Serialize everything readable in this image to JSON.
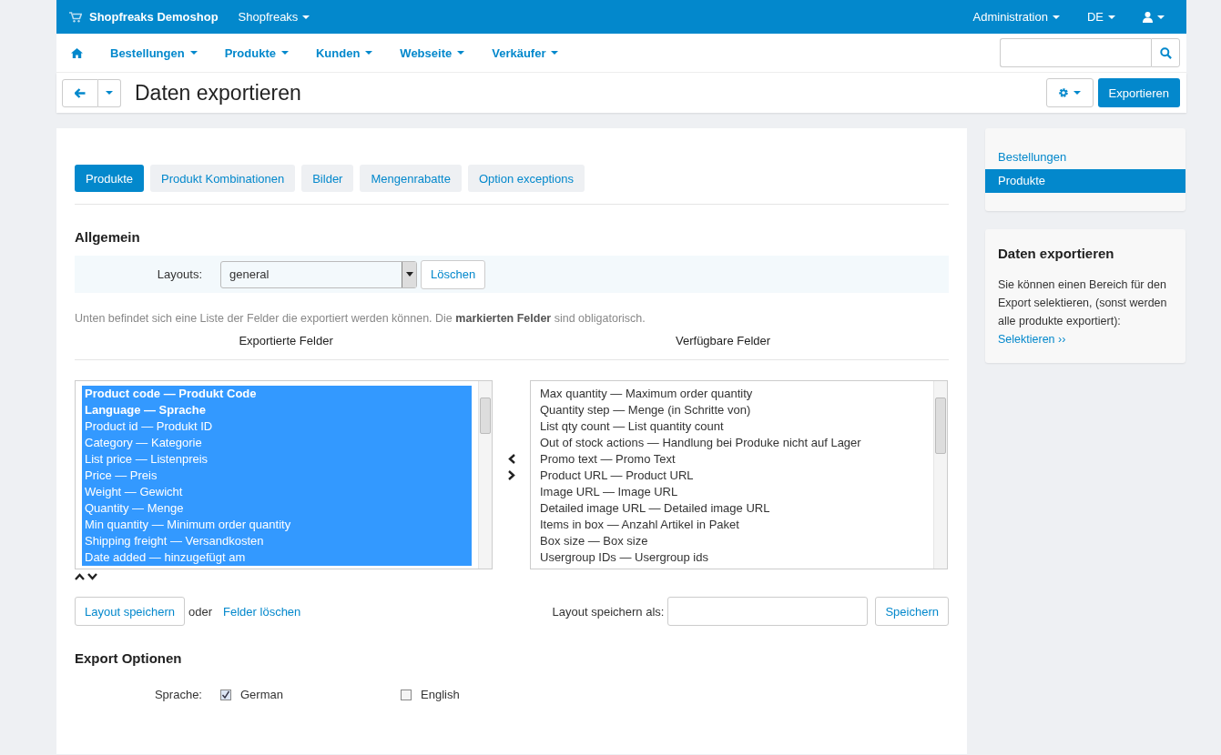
{
  "top_bar": {
    "store": "Shopfreaks Demoshop",
    "vendor_menu": "Shopfreaks",
    "right_menus": [
      {
        "label": "Administration",
        "kind": "text"
      },
      {
        "label": "DE",
        "kind": "text"
      },
      {
        "kind": "user"
      }
    ]
  },
  "nav": {
    "items": [
      "Bestellungen",
      "Produkte",
      "Kunden",
      "Webseite",
      "Verkäufer"
    ]
  },
  "title_bar": {
    "title": "Daten exportieren",
    "action_button": "Exportieren"
  },
  "tabs": [
    {
      "label": "Produkte",
      "selected": true
    },
    {
      "label": "Produkt Kombinationen",
      "selected": false
    },
    {
      "label": "Bilder",
      "selected": false
    },
    {
      "label": "Mengenrabatte",
      "selected": false
    },
    {
      "label": "Option exceptions",
      "selected": false
    }
  ],
  "general": {
    "heading": "Allgemein",
    "layouts_label": "Layouts:",
    "layout_value": "general",
    "delete_button": "Löschen",
    "note": "Unten befindet sich eine Liste der Felder die exportiert werden können. Die **markierten Felder** sind obligatorisch.",
    "exported_heading": "Exportierte Felder",
    "available_heading": "Verfügbare Felder"
  },
  "exported_fields": [
    {
      "label": "Product code — Produkt Code",
      "required": true,
      "selected": true
    },
    {
      "label": "Language — Sprache",
      "required": true,
      "selected": true
    },
    {
      "label": "Product id — Produkt ID",
      "required": false,
      "selected": true
    },
    {
      "label": "Category — Kategorie",
      "required": false,
      "selected": true
    },
    {
      "label": "List price — Listenpreis",
      "required": false,
      "selected": true
    },
    {
      "label": "Price — Preis",
      "required": false,
      "selected": true
    },
    {
      "label": "Weight — Gewicht",
      "required": false,
      "selected": true
    },
    {
      "label": "Quantity — Menge",
      "required": false,
      "selected": true
    },
    {
      "label": "Min quantity — Minimum order quantity",
      "required": false,
      "selected": true
    },
    {
      "label": "Shipping freight — Versandkosten",
      "required": false,
      "selected": true
    },
    {
      "label": "Date added — hinzugefügt am",
      "required": false,
      "selected": true
    }
  ],
  "available_fields": [
    {
      "label": "Max quantity — Maximum order quantity",
      "selected": false
    },
    {
      "label": "Quantity step — Menge (in Schritte von)",
      "selected": false
    },
    {
      "label": "List qty count — List quantity count",
      "selected": false
    },
    {
      "label": "Out of stock actions — Handlung bei Produke nicht auf Lager",
      "selected": false
    },
    {
      "label": "Promo text — Promo Text",
      "selected": false
    },
    {
      "label": "Product URL — Product URL",
      "selected": false
    },
    {
      "label": "Image URL — Image URL",
      "selected": false
    },
    {
      "label": "Detailed image URL — Detailed image URL",
      "selected": false
    },
    {
      "label": "Items in box — Anzahl Artikel in Paket",
      "selected": false
    },
    {
      "label": "Box size — Box size",
      "selected": false
    },
    {
      "label": "Usergroup IDs — Usergroup ids",
      "selected": false
    }
  ],
  "layout_actions": {
    "save_button": "Layout speichern",
    "or": "oder",
    "clear_link": "Felder löschen",
    "save_as_label": "Layout speichern als:",
    "submit_button": "Speichern"
  },
  "export_options": {
    "heading": "Export Optionen",
    "language_label": "Sprache:",
    "languages": [
      {
        "label": "German",
        "checked": true
      },
      {
        "label": "English",
        "checked": false
      }
    ]
  },
  "sidebar": {
    "items": [
      {
        "label": "Bestellungen",
        "selected": false
      },
      {
        "label": "Produkte",
        "selected": true
      }
    ],
    "info": {
      "heading": "Daten exportieren",
      "text": "Sie können einen Bereich für den Export selektieren, (sonst werden alle produkte exportiert):",
      "link": "Selektieren ››"
    }
  }
}
